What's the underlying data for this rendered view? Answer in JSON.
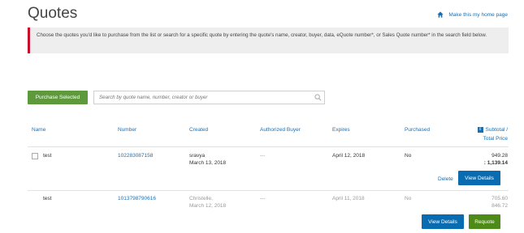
{
  "page": {
    "title": "Quotes",
    "home_link": "Make this my home page",
    "notice": "Choose the quotes you'd like to purchase from the list or search for a specific quote by entering the quote's name, creator, buyer, data, eQuote number*, or Sales Quote number* in the search field below."
  },
  "toolbar": {
    "purchase_selected": "Purchase Selected",
    "search_placeholder": "Search by quote name, number, creator or buyer"
  },
  "table": {
    "headers": {
      "name": "Name",
      "number": "Number",
      "created": "Created",
      "buyer": "Authorized Buyer",
      "expires": "Expires",
      "purchased": "Purchased",
      "total_line1": "Subtotal /",
      "total_line2": "Total Price"
    },
    "rows": [
      {
        "name": "test",
        "number": "102283087158",
        "created_by": "sravya",
        "created_date": "March 13, 2018",
        "buyer": "---",
        "expires": "April 12, 2018",
        "purchased": "No",
        "subtotal": "949.28",
        "total": ": 1,139.14",
        "action_delete": "Delete",
        "action_view": "View Details"
      },
      {
        "name": "test",
        "number": "1013798790616",
        "created_by": "Christelle,",
        "created_date": "March 12, 2018",
        "buyer": "---",
        "expires": "April 11, 2018",
        "purchased": "No",
        "subtotal": "705.60",
        "total": "846.72",
        "action_view": "View Details",
        "action_requote": "Requote"
      }
    ]
  },
  "colors": {
    "accent_blue": "#0a6cb0",
    "link_blue": "#1a6fb4",
    "green": "#5e9a3c",
    "requote_green": "#4d8a18",
    "alert_red": "#c8102e"
  }
}
